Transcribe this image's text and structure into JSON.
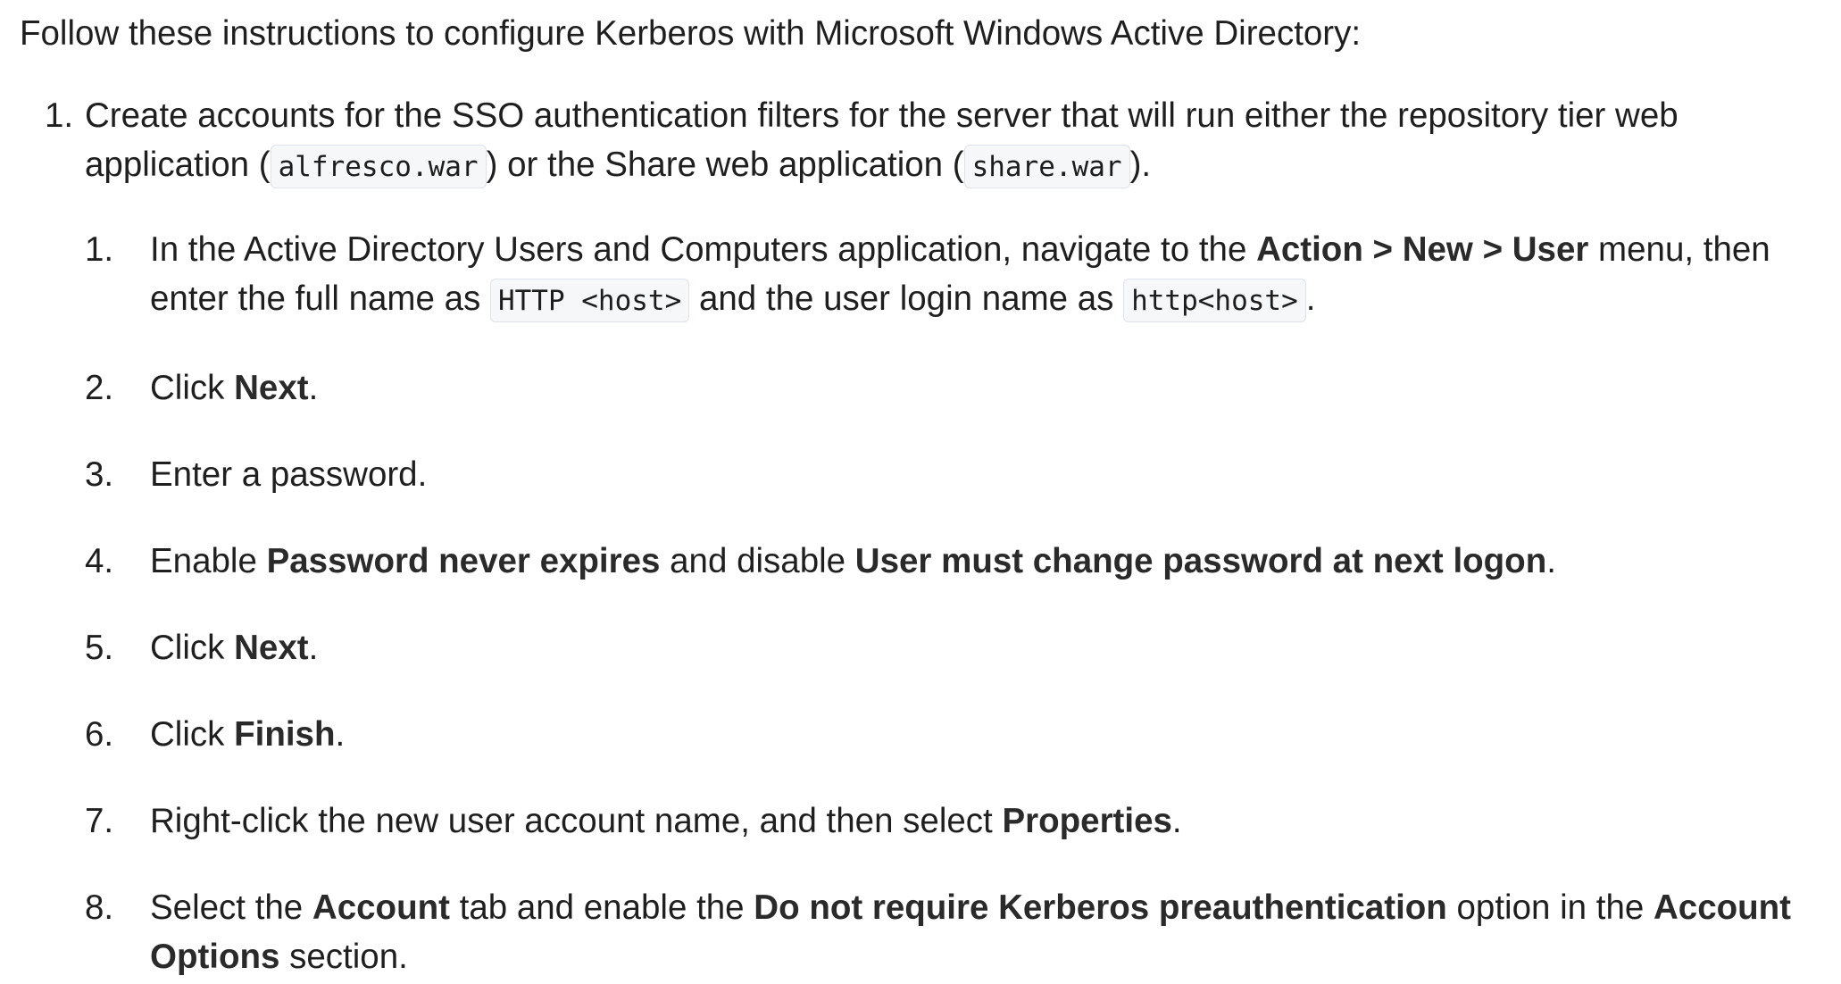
{
  "doc": {
    "intro": "Follow these instructions to configure Kerberos with Microsoft Windows Active Directory:",
    "step1": {
      "number": "1.",
      "text_a": "Create accounts for the SSO authentication filters for the server that will run either the repository tier web application (",
      "code_a": "alfresco.war",
      "text_b": ") or the Share web application (",
      "code_b": "share.war",
      "text_c": ").",
      "substeps": {
        "s1": {
          "number": "1.",
          "t1": "In the Active Directory Users and Computers application, navigate to the ",
          "b1": "Action > New > User",
          "t2": " menu, then enter the full name as ",
          "c1": "HTTP <host>",
          "t3": " and the user login name as ",
          "c2": "http<host>",
          "t4": "."
        },
        "s2": {
          "number": "2.",
          "t1": "Click ",
          "b1": "Next",
          "t2": "."
        },
        "s3": {
          "number": "3.",
          "t1": "Enter a password."
        },
        "s4": {
          "number": "4.",
          "t1": "Enable ",
          "b1": "Password never expires",
          "t2": " and disable ",
          "b2": "User must change password at next logon",
          "t3": "."
        },
        "s5": {
          "number": "5.",
          "t1": "Click ",
          "b1": "Next",
          "t2": "."
        },
        "s6": {
          "number": "6.",
          "t1": "Click ",
          "b1": "Finish",
          "t2": "."
        },
        "s7": {
          "number": "7.",
          "t1": "Right-click the new user account name, and then select ",
          "b1": "Properties",
          "t2": "."
        },
        "s8": {
          "number": "8.",
          "t1": "Select the ",
          "b1": "Account",
          "t2": " tab and enable the ",
          "b2": "Do not require Kerberos preauthentication",
          "t3": " option in the ",
          "b3": "Account Options",
          "t4": " section."
        }
      }
    }
  }
}
